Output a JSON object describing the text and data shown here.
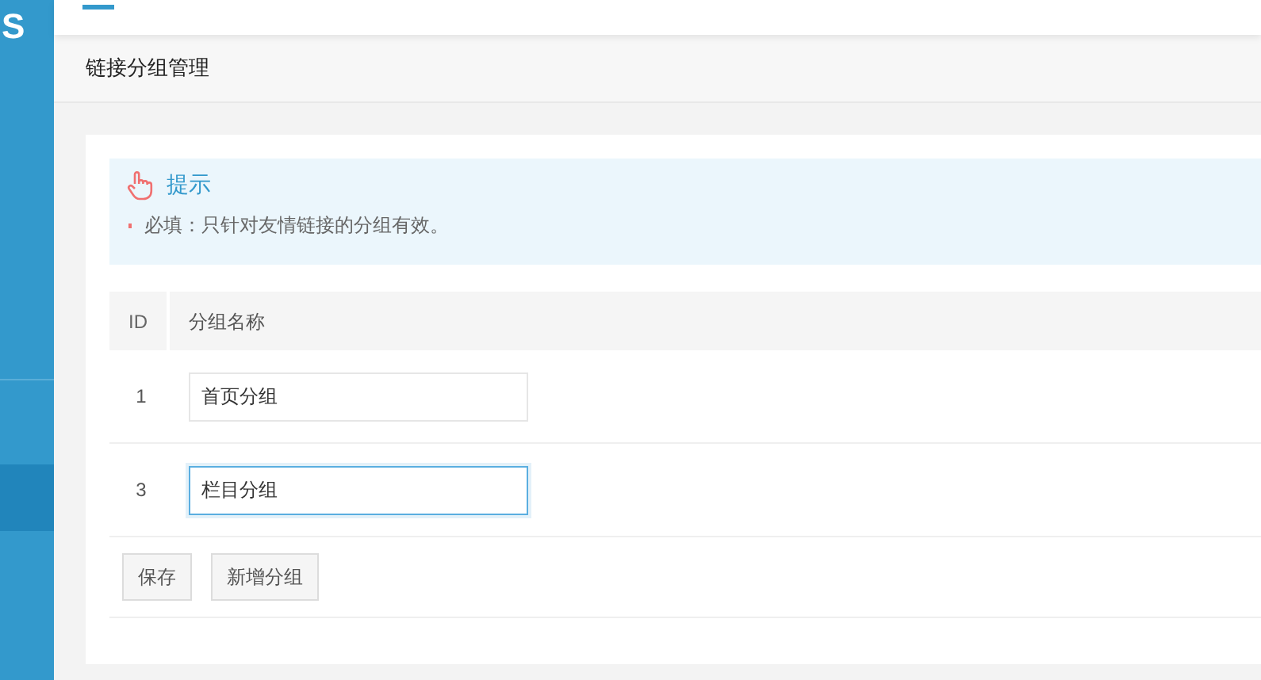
{
  "sidebar": {
    "logo": "S",
    "items": [
      {
        "selected": true
      }
    ]
  },
  "page_title": "链接分组管理",
  "tip": {
    "title": "提示",
    "lines": [
      "必填：只针对友情链接的分组有效。"
    ]
  },
  "table": {
    "columns": [
      "ID",
      "分组名称"
    ],
    "rows": [
      {
        "id": "1",
        "name": "首页分组",
        "focused": false
      },
      {
        "id": "3",
        "name": "栏目分组",
        "focused": true
      }
    ]
  },
  "buttons": [
    "保存",
    "新增分组"
  ]
}
